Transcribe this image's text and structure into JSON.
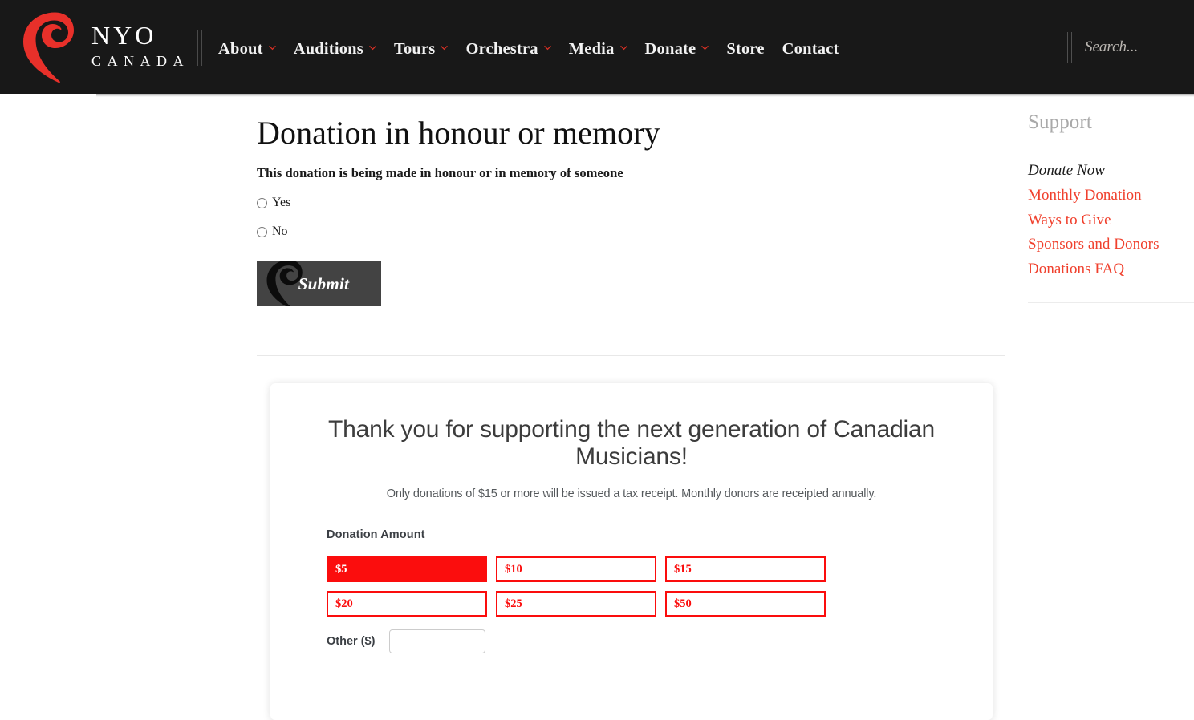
{
  "header": {
    "brand": {
      "line1": "NYO",
      "line2": "CANADA",
      "logo_icon": "bass-clef-spiral-icon",
      "logo_color": "#e8302a"
    },
    "nav": [
      {
        "label": "About",
        "has_dropdown": true
      },
      {
        "label": "Auditions",
        "has_dropdown": true
      },
      {
        "label": "Tours",
        "has_dropdown": true
      },
      {
        "label": "Orchestra",
        "has_dropdown": true
      },
      {
        "label": "Media",
        "has_dropdown": true
      },
      {
        "label": "Donate",
        "has_dropdown": true
      },
      {
        "label": "Store",
        "has_dropdown": false
      },
      {
        "label": "Contact",
        "has_dropdown": false
      }
    ],
    "search": {
      "placeholder": "Search...",
      "value": ""
    },
    "background_color": "#181818",
    "caret_color": "#d93025"
  },
  "main": {
    "title": "Donation in honour or memory",
    "form_label": "This donation is being made in honour or in memory of someone",
    "radio_options": [
      {
        "label": "Yes",
        "checked": false
      },
      {
        "label": "No",
        "checked": false
      }
    ],
    "submit_label": "Submit",
    "submit_background": "#434343"
  },
  "donation_card": {
    "heading": "Thank you for supporting the next generation of Canadian Musicians!",
    "subtext": "Only donations of $15 or more will be issued a tax receipt. Monthly donors are receipted annually.",
    "amount_label": "Donation Amount",
    "amounts": [
      {
        "label": "$5",
        "selected": true
      },
      {
        "label": "$10",
        "selected": false
      },
      {
        "label": "$15",
        "selected": false
      },
      {
        "label": "$20",
        "selected": false
      },
      {
        "label": "$25",
        "selected": false
      },
      {
        "label": "$50",
        "selected": false
      }
    ],
    "other_label": "Other ($)",
    "other_value": "",
    "accent_color": "#fb0d0d"
  },
  "sidebar": {
    "title": "Support",
    "links": [
      {
        "label": "Donate Now",
        "active": true
      },
      {
        "label": "Monthly Donation",
        "active": false
      },
      {
        "label": "Ways to Give",
        "active": false
      },
      {
        "label": "Sponsors and Donors",
        "active": false
      },
      {
        "label": "Donations FAQ",
        "active": false
      }
    ],
    "link_color": "#f0402d"
  }
}
